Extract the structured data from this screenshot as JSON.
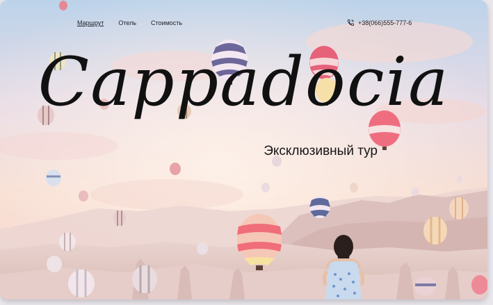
{
  "nav": {
    "items": [
      {
        "label": "Маршрут",
        "active": true
      },
      {
        "label": "Отель",
        "active": false
      },
      {
        "label": "Стоимость",
        "active": false
      }
    ]
  },
  "contact": {
    "phone": "+38(066)555-777-6",
    "icon": "phone-icon"
  },
  "hero": {
    "title": "Cappadocia",
    "subtitle": "Эксклюзивный тур",
    "scene": "balloons-over-valley"
  },
  "colors": {
    "text": "#1e1e28",
    "sky_top": "#b9cfe6",
    "sky_glow": "#f7d6c6",
    "rock": "#e3cdca"
  }
}
